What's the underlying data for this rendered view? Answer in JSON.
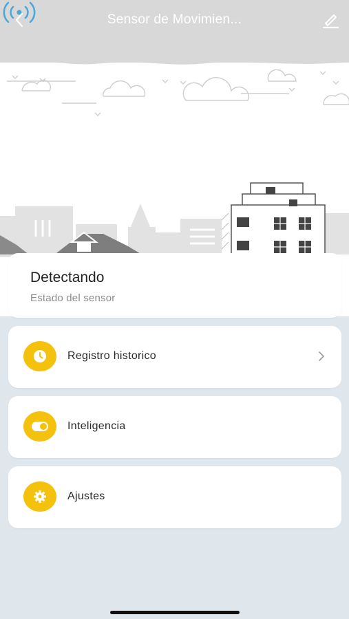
{
  "header": {
    "title": "Sensor de Movimien..."
  },
  "status": {
    "value": "Detectando",
    "label": "Estado del sensor"
  },
  "menu": [
    {
      "label": "Registro historico",
      "icon": "clock-icon",
      "has_chevron": true
    },
    {
      "label": "Inteligencia",
      "icon": "toggle-icon",
      "has_chevron": false
    },
    {
      "label": "Ajustes",
      "icon": "gear-icon",
      "has_chevron": false
    }
  ],
  "colors": {
    "accent": "#f4c20d",
    "signal": "#4aa8d8",
    "background": "#dfe6ec",
    "header": "#d8d8d8"
  }
}
